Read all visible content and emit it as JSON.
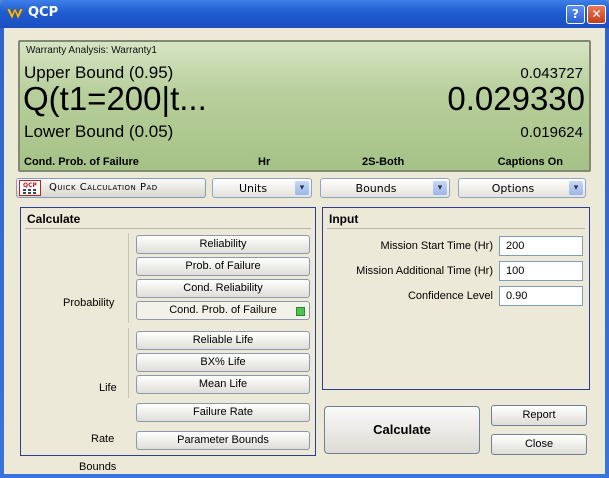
{
  "window": {
    "title": "QCP"
  },
  "display": {
    "analysis": "Warranty Analysis: Warranty1",
    "upper_label": "Upper Bound (0.95)",
    "upper_value": "0.043727",
    "main_label": "Q(t1=200|t...",
    "main_value": "0.029330",
    "lower_label": "Lower Bound (0.05)",
    "lower_value": "0.019624",
    "status": {
      "metric": "Cond. Prob. of Failure",
      "units": "Hr",
      "bounds": "2S-Both",
      "captions": "Captions On"
    }
  },
  "toolbar": {
    "qcp_badge": "QCP",
    "pad_label": "Quick Calculation Pad",
    "units": "Units",
    "bounds": "Bounds",
    "options": "Options"
  },
  "calculate": {
    "title": "Calculate",
    "groups": {
      "probability": "Probability",
      "life": "Life",
      "rate": "Rate",
      "bounds": "Bounds"
    },
    "buttons": {
      "reliability": "Reliability",
      "prob_failure": "Prob. of Failure",
      "cond_reliability": "Cond. Reliability",
      "cond_prob_failure": "Cond. Prob. of Failure",
      "reliable_life": "Reliable Life",
      "bx_life": "BX% Life",
      "mean_life": "Mean Life",
      "failure_rate": "Failure Rate",
      "parameter_bounds": "Parameter Bounds"
    }
  },
  "input": {
    "title": "Input",
    "mission_start_label": "Mission Start Time (Hr)",
    "mission_start_value": "200",
    "mission_add_label": "Mission Additional Time (Hr)",
    "mission_add_value": "100",
    "confidence_label": "Confidence Level",
    "confidence_value": "0.90"
  },
  "actions": {
    "calculate": "Calculate",
    "report": "Report",
    "close": "Close"
  },
  "colors": {
    "titlebar": "#1f5bd1",
    "display_bg": "#b7cf9b",
    "panel_border": "#2a3f8f",
    "led": "#4fc24f"
  }
}
